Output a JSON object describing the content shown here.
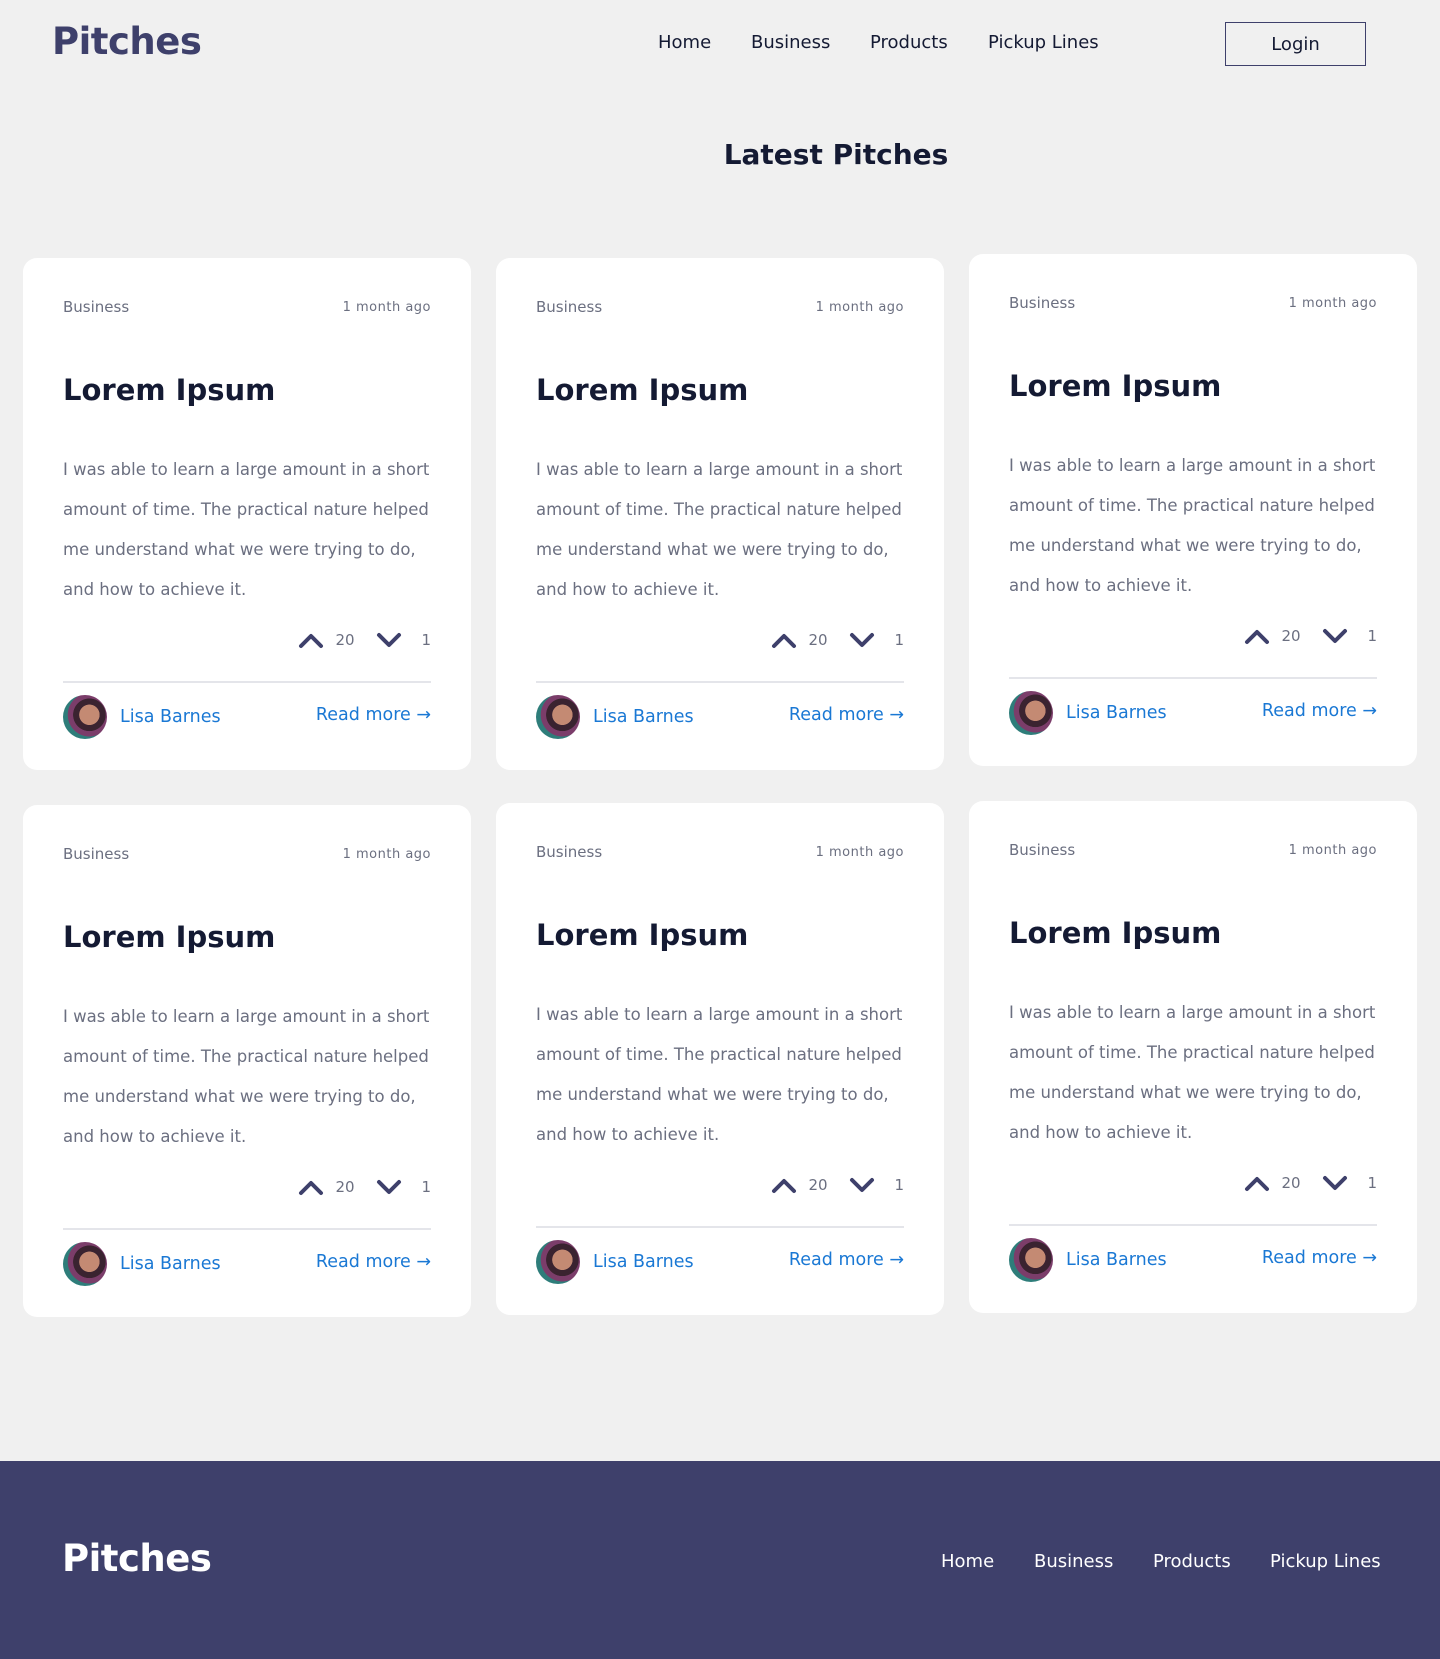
{
  "header": {
    "logo": "Pitches",
    "nav": [
      "Home",
      "Business",
      "Products",
      "Pickup Lines"
    ],
    "login": "Login"
  },
  "heading": "Latest Pitches",
  "cards": [
    {
      "category": "Business",
      "time": "1 month ago",
      "title": "Lorem Ipsum",
      "body": "I was able to learn a large amount in a short amount of time. The practical nature helped me understand what we were trying to do, and how to achieve it.",
      "upvotes": "20",
      "downvotes": "1",
      "author": "Lisa Barnes",
      "read_more": "Read more →"
    },
    {
      "category": "Business",
      "time": "1 month ago",
      "title": "Lorem Ipsum",
      "body": "I was able to learn a large amount in a short amount of time. The practical nature helped me understand what we were trying to do, and how to achieve it.",
      "upvotes": "20",
      "downvotes": "1",
      "author": "Lisa Barnes",
      "read_more": "Read more →"
    },
    {
      "category": "Business",
      "time": "1 month ago",
      "title": "Lorem Ipsum",
      "body": "I was able to learn a large amount in a short amount of time. The practical nature helped me understand what we were trying to do, and how to achieve it.",
      "upvotes": "20",
      "downvotes": "1",
      "author": "Lisa Barnes",
      "read_more": "Read more →"
    },
    {
      "category": "Business",
      "time": "1 month ago",
      "title": "Lorem Ipsum",
      "body": "I was able to learn a large amount in a short amount of time. The practical nature helped me understand what we were trying to do, and how to achieve it.",
      "upvotes": "20",
      "downvotes": "1",
      "author": "Lisa Barnes",
      "read_more": "Read more →"
    },
    {
      "category": "Business",
      "time": "1 month ago",
      "title": "Lorem Ipsum",
      "body": "I was able to learn a large amount in a short amount of time. The practical nature helped me understand what we were trying to do, and how to achieve it.",
      "upvotes": "20",
      "downvotes": "1",
      "author": "Lisa Barnes",
      "read_more": "Read more →"
    },
    {
      "category": "Business",
      "time": "1 month ago",
      "title": "Lorem Ipsum",
      "body": "I was able to learn a large amount in a short amount of time. The practical nature helped me understand what we were trying to do, and how to achieve it.",
      "upvotes": "20",
      "downvotes": "1",
      "author": "Lisa Barnes",
      "read_more": "Read more →"
    }
  ],
  "footer": {
    "logo": "Pitches",
    "nav": [
      "Home",
      "Business",
      "Products",
      "Pickup Lines"
    ]
  },
  "colors": {
    "brand": "#3e406b",
    "link": "#1a78d4",
    "background": "#f0f0f0",
    "card": "#ffffff"
  },
  "icons": {
    "upvote": "chevron-up-icon",
    "downvote": "chevron-down-icon",
    "read_more_arrow": "arrow-right-icon"
  }
}
